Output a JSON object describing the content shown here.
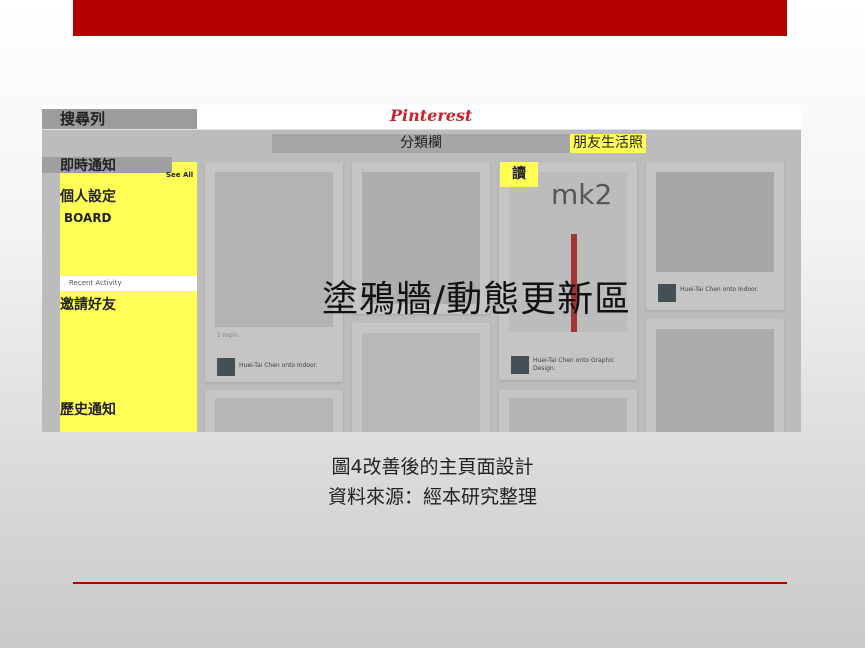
{
  "slide": {
    "caption_line1": "圖4改善後的主頁面設計",
    "caption_line2": "資料來源：經本研究整理",
    "accent_color": "#b40000"
  },
  "mockup": {
    "search_label": "搜尋列",
    "logo": "Pinterest",
    "category_label": "分類欄",
    "friends_label": "朋友生活照",
    "notifications_label": "即時通知",
    "see_all": "See All",
    "personal_settings": "個人設定",
    "board": "BOARD",
    "recent_activity": "Recent Activity",
    "invite_friends": "邀請好友",
    "history_notifications": "歷史通知",
    "feed_label": "塗鴉牆/動態更新區",
    "read_label": "讀",
    "highlight_color": "#ffff55"
  },
  "pins": [
    {
      "attribution": "Huei-Tai Chen onto Indoor."
    },
    {
      "attribution": "Huei-Tai Chen onto Graphic Design."
    },
    {
      "attribution": "Huei-Tai Chen onto Indoor."
    }
  ],
  "pin_texts": {
    "likes": "1 repin",
    "mk2": "mk2"
  }
}
